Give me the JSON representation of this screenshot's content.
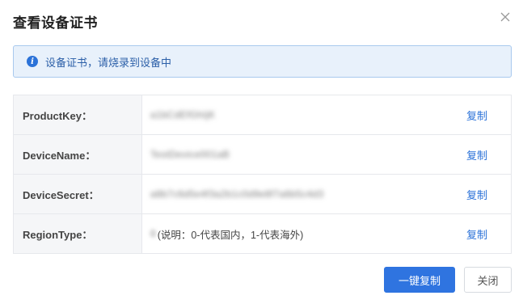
{
  "dialog": {
    "title": "查看设备证书",
    "close_icon": "close-icon"
  },
  "alert": {
    "icon": "info-icon",
    "icon_glyph": "i",
    "text": "设备证书，请烧录到设备中"
  },
  "rows": [
    {
      "label": "ProductKey：",
      "value": "a1bCdEfGhIjK",
      "copy": "复制"
    },
    {
      "label": "DeviceName：",
      "value": "TestDevice001aB",
      "copy": "复制"
    },
    {
      "label": "DeviceSecret：",
      "value": "a8b7c6d5e4f3a2b1c0d9e8f7a6b5c4d3",
      "copy": "复制"
    },
    {
      "label": "RegionType：",
      "value": "0",
      "note": "(说明：0-代表国内，1-代表海外)",
      "copy": "复制"
    }
  ],
  "footer": {
    "copy_all_label": "一键复制",
    "close_label": "关闭"
  },
  "colors": {
    "primary": "#2f74e0",
    "link": "#2b72d8",
    "alert_bg": "#e8f1fb",
    "alert_border": "#a8c9ee"
  }
}
